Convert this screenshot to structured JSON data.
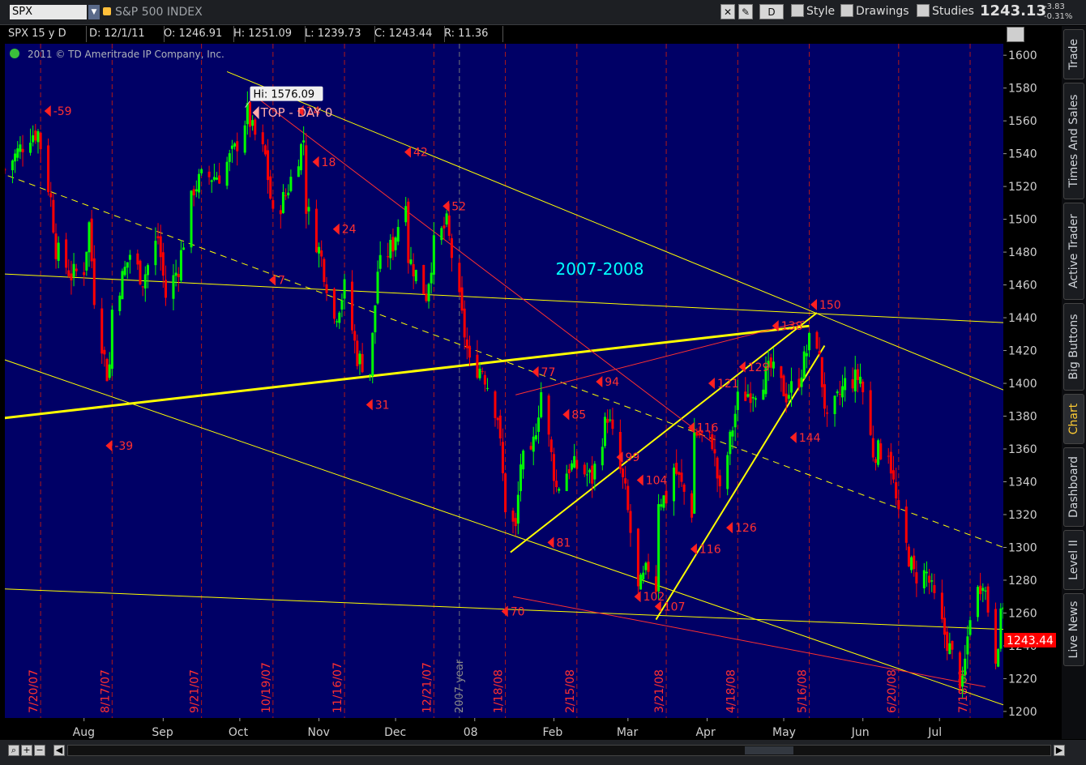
{
  "header": {
    "symbol": "SPX",
    "description": "S&P 500 INDEX",
    "toolbar": {
      "period_button": "D",
      "style": "Style",
      "drawings": "Drawings",
      "studies": "Studies"
    },
    "last_price": "1243.13",
    "change": "-3.83",
    "change_pct": "-0.31%"
  },
  "infobar": {
    "symbol": "SPX 15 y D",
    "date": "D: 12/1/11",
    "open": "O: 1246.91",
    "high": "H: 1251.09",
    "low": "L: 1239.73",
    "close": "C: 1243.44",
    "range": "R: 11.36"
  },
  "copyright": "2011 © TD Ameritrade IP Company, Inc.",
  "right_tabs": [
    "Trade",
    "Times And Sales",
    "Active Trader",
    "Big Buttons",
    "Chart",
    "Dashboard",
    "Level II",
    "Live News"
  ],
  "active_tab": "Chart",
  "colors": {
    "background": "#000066",
    "up": "#00ff00",
    "down": "#ff0000",
    "trendline": "#ffff00",
    "redline": "#ff3030",
    "marker": "#ff3030",
    "title": "#00ffff",
    "price_label": "#ff0000"
  },
  "chart_data": {
    "type": "candlestick",
    "instrument": "SPX",
    "aggregation": "Daily",
    "title": "2007-2008",
    "ylim": [
      1196,
      1607
    ],
    "y_ticks": [
      1200,
      1220,
      1240,
      1260,
      1280,
      1300,
      1320,
      1340,
      1360,
      1380,
      1400,
      1420,
      1440,
      1460,
      1480,
      1500,
      1520,
      1540,
      1560,
      1580,
      1600
    ],
    "x_range": [
      "2007-07-06",
      "2008-07-31"
    ],
    "x_month_labels": [
      {
        "label": "Aug",
        "date": "2007-08-06"
      },
      {
        "label": "Sep",
        "date": "2007-09-06"
      },
      {
        "label": "Oct",
        "date": "2007-10-06"
      },
      {
        "label": "Nov",
        "date": "2007-11-06"
      },
      {
        "label": "Dec",
        "date": "2007-12-06"
      },
      {
        "label": "08",
        "date": "2008-01-06"
      },
      {
        "label": "Feb",
        "date": "2008-02-06"
      },
      {
        "label": "Mar",
        "date": "2008-03-06"
      },
      {
        "label": "Apr",
        "date": "2008-04-06"
      },
      {
        "label": "May",
        "date": "2008-05-06"
      },
      {
        "label": "Jun",
        "date": "2008-06-06"
      },
      {
        "label": "Jul",
        "date": "2008-07-06"
      }
    ],
    "vertical_markers": [
      {
        "label": "7/20/07",
        "date": "2007-07-20"
      },
      {
        "label": "8/17/07",
        "date": "2007-08-17"
      },
      {
        "label": "9/21/07",
        "date": "2007-09-21"
      },
      {
        "label": "10/19/07",
        "date": "2007-10-19"
      },
      {
        "label": "11/16/07",
        "date": "2007-11-16"
      },
      {
        "label": "12/21/07",
        "date": "2007-12-21"
      },
      {
        "label": "1/18/08",
        "date": "2008-01-18"
      },
      {
        "label": "2/15/08",
        "date": "2008-02-15"
      },
      {
        "label": "3/21/08",
        "date": "2008-03-21"
      },
      {
        "label": "4/18/08",
        "date": "2008-04-18"
      },
      {
        "label": "5/16/08",
        "date": "2008-05-16"
      },
      {
        "label": "6/20/08",
        "date": "2008-06-20"
      },
      {
        "label": "7/18/08",
        "date": "2008-07-18"
      }
    ],
    "year_marker": {
      "label": "2007 year",
      "date": "2007-12-31"
    },
    "close_series": [
      [
        "2007-07-06",
        1530
      ],
      [
        "2007-07-16",
        1552
      ],
      [
        "2007-07-19",
        1553
      ],
      [
        "2007-07-24",
        1512
      ],
      [
        "2007-07-26",
        1482
      ],
      [
        "2007-08-01",
        1466
      ],
      [
        "2007-08-06",
        1470
      ],
      [
        "2007-08-08",
        1497
      ],
      [
        "2007-08-10",
        1453
      ],
      [
        "2007-08-15",
        1406
      ],
      [
        "2007-08-16",
        1411
      ],
      [
        "2007-08-17",
        1445
      ],
      [
        "2007-08-24",
        1479
      ],
      [
        "2007-08-29",
        1463
      ],
      [
        "2007-09-04",
        1489
      ],
      [
        "2007-09-07",
        1453
      ],
      [
        "2007-09-12",
        1471
      ],
      [
        "2007-09-18",
        1519
      ],
      [
        "2007-09-21",
        1525
      ],
      [
        "2007-09-28",
        1527
      ],
      [
        "2007-10-04",
        1542
      ],
      [
        "2007-10-09",
        1565
      ],
      [
        "2007-10-11",
        1554
      ],
      [
        "2007-10-16",
        1538
      ],
      [
        "2007-10-19",
        1501
      ],
      [
        "2007-10-24",
        1515
      ],
      [
        "2007-10-31",
        1549
      ],
      [
        "2007-11-01",
        1508
      ],
      [
        "2007-11-07",
        1476
      ],
      [
        "2007-11-12",
        1439
      ],
      [
        "2007-11-16",
        1458
      ],
      [
        "2007-11-21",
        1416
      ],
      [
        "2007-11-26",
        1407
      ],
      [
        "2007-11-29",
        1469
      ],
      [
        "2007-12-05",
        1485
      ],
      [
        "2007-12-10",
        1515
      ],
      [
        "2007-12-11",
        1477
      ],
      [
        "2007-12-14",
        1467
      ],
      [
        "2007-12-18",
        1454
      ],
      [
        "2007-12-21",
        1484
      ],
      [
        "2007-12-26",
        1497
      ],
      [
        "2007-12-28",
        1478
      ],
      [
        "2008-01-04",
        1411
      ],
      [
        "2008-01-09",
        1409
      ],
      [
        "2008-01-15",
        1380
      ],
      [
        "2008-01-18",
        1325
      ],
      [
        "2008-01-22",
        1310
      ],
      [
        "2008-01-24",
        1352
      ],
      [
        "2008-01-28",
        1353
      ],
      [
        "2008-02-01",
        1395
      ],
      [
        "2008-02-07",
        1336
      ],
      [
        "2008-02-12",
        1349
      ],
      [
        "2008-02-15",
        1349
      ],
      [
        "2008-02-21",
        1342
      ],
      [
        "2008-02-27",
        1381
      ],
      [
        "2008-03-05",
        1333
      ],
      [
        "2008-03-10",
        1273
      ],
      [
        "2008-03-14",
        1288
      ],
      [
        "2008-03-17",
        1276
      ],
      [
        "2008-03-18",
        1330
      ],
      [
        "2008-03-21",
        1330
      ],
      [
        "2008-03-24",
        1349
      ],
      [
        "2008-03-31",
        1322
      ],
      [
        "2008-04-01",
        1370
      ],
      [
        "2008-04-08",
        1365
      ],
      [
        "2008-04-11",
        1332
      ],
      [
        "2008-04-18",
        1390
      ],
      [
        "2008-04-25",
        1397
      ],
      [
        "2008-05-01",
        1409
      ],
      [
        "2008-05-07",
        1393
      ],
      [
        "2008-05-12",
        1403
      ],
      [
        "2008-05-16",
        1425
      ],
      [
        "2008-05-19",
        1426
      ],
      [
        "2008-05-23",
        1375
      ],
      [
        "2008-05-30",
        1400
      ],
      [
        "2008-06-05",
        1404
      ],
      [
        "2008-06-10",
        1358
      ],
      [
        "2008-06-16",
        1360
      ],
      [
        "2008-06-20",
        1317
      ],
      [
        "2008-06-26",
        1283
      ],
      [
        "2008-07-01",
        1284
      ],
      [
        "2008-07-07",
        1252
      ],
      [
        "2008-07-15",
        1215
      ],
      [
        "2008-07-18",
        1260
      ],
      [
        "2008-07-23",
        1282
      ],
      [
        "2008-07-28",
        1234
      ],
      [
        "2008-07-31",
        1267
      ]
    ],
    "highlight_labels": [
      {
        "text": "Hi: 1576.09",
        "date": "2007-10-10",
        "price": 1576.09
      },
      {
        "text": "TOP - DAY 0",
        "date": "2007-10-11",
        "price": 1565
      }
    ],
    "day_markers": [
      {
        "label": "-59",
        "date": "2007-07-24",
        "price": 1566
      },
      {
        "label": "-39",
        "date": "2007-08-17",
        "price": 1362
      },
      {
        "label": "14",
        "date": "2007-10-31",
        "price": 1566
      },
      {
        "label": "18",
        "date": "2007-11-06",
        "price": 1535
      },
      {
        "label": "24",
        "date": "2007-11-14",
        "price": 1494
      },
      {
        "label": "7",
        "date": "2007-10-20",
        "price": 1463
      },
      {
        "label": "31",
        "date": "2007-11-27",
        "price": 1387
      },
      {
        "label": "42",
        "date": "2007-12-12",
        "price": 1541
      },
      {
        "label": "52",
        "date": "2007-12-27",
        "price": 1508
      },
      {
        "label": "70",
        "date": "2008-01-19",
        "price": 1261
      },
      {
        "label": "77",
        "date": "2008-01-31",
        "price": 1407
      },
      {
        "label": "81",
        "date": "2008-02-06",
        "price": 1303
      },
      {
        "label": "85",
        "date": "2008-02-12",
        "price": 1381
      },
      {
        "label": "94",
        "date": "2008-02-25",
        "price": 1401
      },
      {
        "label": "99",
        "date": "2008-03-04",
        "price": 1355
      },
      {
        "label": "102",
        "date": "2008-03-11",
        "price": 1270
      },
      {
        "label": "104",
        "date": "2008-03-12",
        "price": 1341
      },
      {
        "label": "107",
        "date": "2008-03-19",
        "price": 1264
      },
      {
        "label": "116",
        "date": "2008-04-01",
        "price": 1373
      },
      {
        "label": "116",
        "date": "2008-04-02",
        "price": 1299
      },
      {
        "label": "121",
        "date": "2008-04-09",
        "price": 1400
      },
      {
        "label": "126",
        "date": "2008-04-16",
        "price": 1312
      },
      {
        "label": "129",
        "date": "2008-04-21",
        "price": 1410
      },
      {
        "label": "138",
        "date": "2008-05-04",
        "price": 1435
      },
      {
        "label": "144",
        "date": "2008-05-11",
        "price": 1367
      },
      {
        "label": "150",
        "date": "2008-05-19",
        "price": 1448
      }
    ],
    "trendlines": [
      {
        "color": "yellow",
        "width": 1,
        "p1": [
          "2007-07-01",
          1467
        ],
        "p2": [
          "2008-07-31",
          1437
        ]
      },
      {
        "color": "yellow",
        "width": 3,
        "p1": [
          "2007-07-01",
          1378
        ],
        "p2": [
          "2008-05-16",
          1435
        ]
      },
      {
        "color": "yellow",
        "width": 1,
        "dash": true,
        "p1": [
          "2007-07-03",
          1529
        ],
        "p2": [
          "2008-07-31",
          1300
        ]
      },
      {
        "color": "yellow",
        "width": 1,
        "p1": [
          "2007-07-01",
          1417
        ],
        "p2": [
          "2008-07-31",
          1204
        ]
      },
      {
        "color": "yellow",
        "width": 1,
        "p1": [
          "2007-07-01",
          1275
        ],
        "p2": [
          "2008-07-31",
          1250
        ]
      },
      {
        "color": "yellow",
        "width": 1,
        "p1": [
          "2007-10-01",
          1590
        ],
        "p2": [
          "2008-07-31",
          1396
        ]
      },
      {
        "color": "yellow",
        "width": 2,
        "p1": [
          "2008-01-20",
          1297
        ],
        "p2": [
          "2008-05-19",
          1443
        ]
      },
      {
        "color": "yellow",
        "width": 2,
        "p1": [
          "2008-03-17",
          1256
        ],
        "p2": [
          "2008-05-22",
          1423
        ]
      },
      {
        "color": "red",
        "width": 1,
        "p1": [
          "2007-10-12",
          1575
        ],
        "p2": [
          "2008-04-08",
          1364
        ]
      },
      {
        "color": "red",
        "width": 1,
        "p1": [
          "2008-01-22",
          1393
        ],
        "p2": [
          "2008-05-14",
          1438
        ]
      },
      {
        "color": "red",
        "width": 1,
        "p1": [
          "2008-01-21",
          1270
        ],
        "p2": [
          "2008-07-24",
          1215
        ]
      }
    ],
    "last_close_label": "1243.44",
    "last_close": 1243.44
  }
}
